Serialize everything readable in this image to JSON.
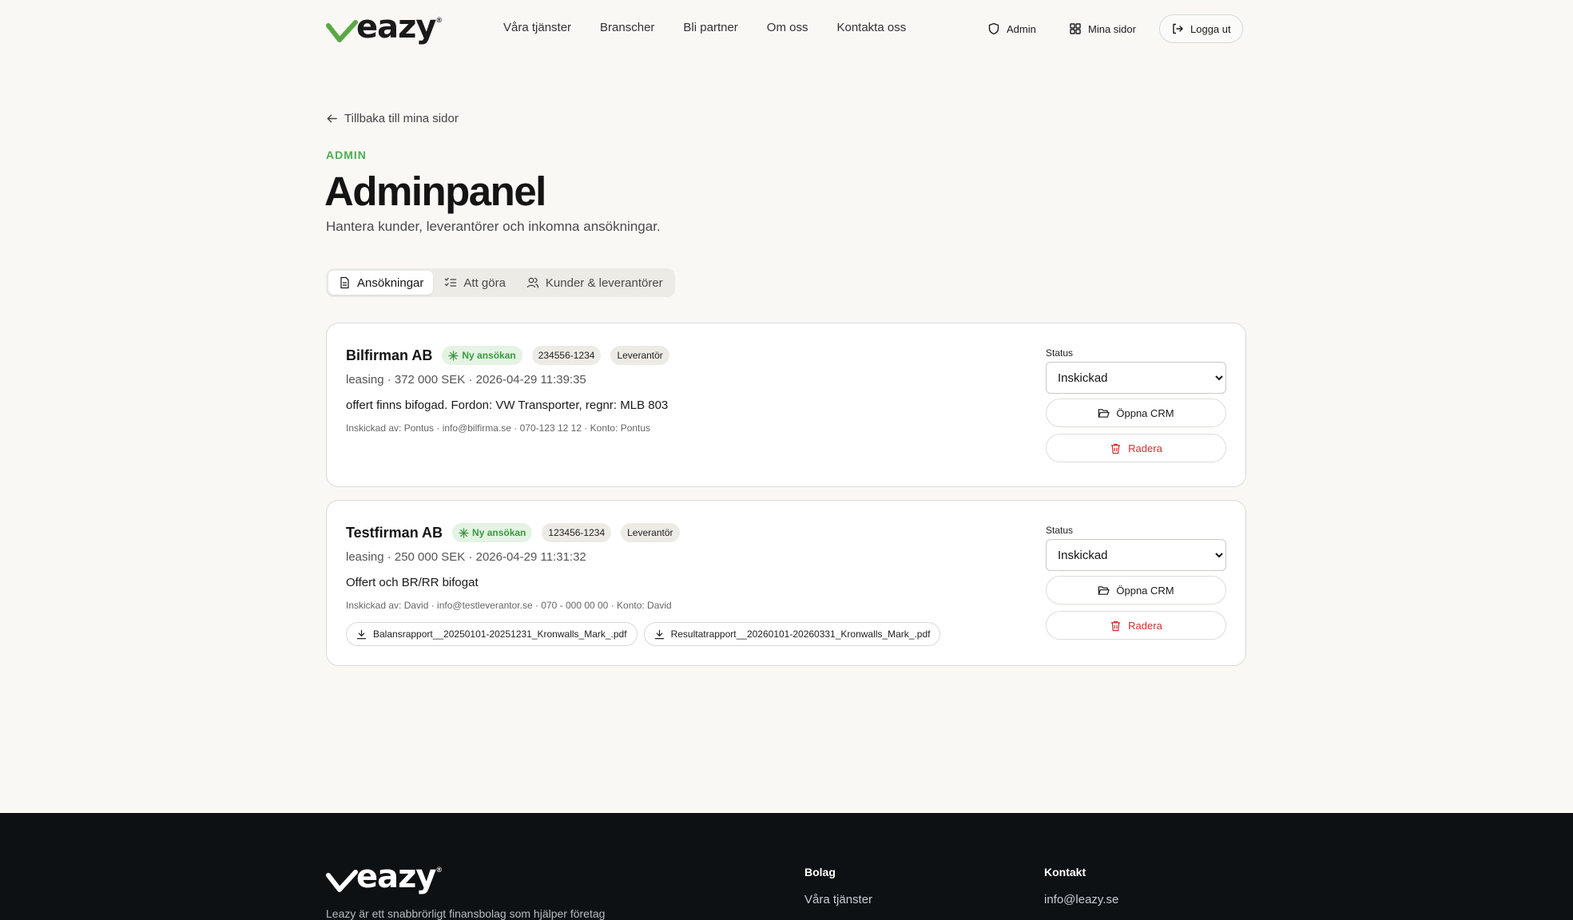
{
  "header": {
    "logo_text": "eazy",
    "logo_reg": "®",
    "nav": [
      "Våra tjänster",
      "Branscher",
      "Bli partner",
      "Om oss",
      "Kontakta oss"
    ],
    "admin_label": "Admin",
    "mina_sidor_label": "Mina sidor",
    "logout_label": "Logga ut"
  },
  "page": {
    "back_label": "Tillbaka till mina sidor",
    "eyebrow": "ADMIN",
    "title": "Adminpanel",
    "lead": "Hantera kunder, leverantörer och inkomna ansökningar.",
    "tabs": [
      {
        "label": "Ansökningar",
        "icon": "document-icon",
        "active": true
      },
      {
        "label": "Att göra",
        "icon": "checklist-icon",
        "active": false
      },
      {
        "label": "Kunder & leverantörer",
        "icon": "users-icon",
        "active": false
      }
    ]
  },
  "applications": [
    {
      "company": "Bilfirman AB",
      "status_badge": "Ny ansökan",
      "org_number": "234556-1234",
      "role_badge": "Leverantör",
      "meta": "leasing · 372 000 SEK · 2026-04-29 11:39:35",
      "description": "offert finns bifogad. Fordon: VW Transporter, regnr: MLB 803",
      "submitted_by": "Inskickad av: Pontus · info@bilfirma.se · 070-123 12 12 · Konto: Pontus",
      "files": [],
      "status_label": "Status",
      "status_value": "Inskickad",
      "crm_label": "Öppna CRM",
      "delete_label": "Radera"
    },
    {
      "company": "Testfirman AB",
      "status_badge": "Ny ansökan",
      "org_number": "123456-1234",
      "role_badge": "Leverantör",
      "meta": "leasing · 250 000 SEK · 2026-04-29 11:31:32",
      "description": "Offert och BR/RR bifogat",
      "submitted_by": "Inskickad av: David · info@testleverantor.se · 070 - 000 00 00 · Konto: David",
      "files": [
        "Balansrapport__20250101-20251231_Kronwalls_Mark_.pdf",
        "Resultatrapport__20260101-20260331_Kronwalls_Mark_.pdf"
      ],
      "status_label": "Status",
      "status_value": "Inskickad",
      "crm_label": "Öppna CRM",
      "delete_label": "Radera"
    }
  ],
  "footer": {
    "logo_text": "eazy",
    "logo_reg": "®",
    "tagline": "Leazy är ett snabbrörligt finansbolag som hjälper företag",
    "col1_heading": "Bolag",
    "col1_items": [
      "Våra tjänster"
    ],
    "col2_heading": "Kontakt",
    "col2_items": [
      "info@leazy.se"
    ]
  },
  "colors": {
    "accent_green": "#4caf50",
    "danger_red": "#d32f2f",
    "background": "#f9f8f5",
    "footer_bg": "#0e1114"
  }
}
